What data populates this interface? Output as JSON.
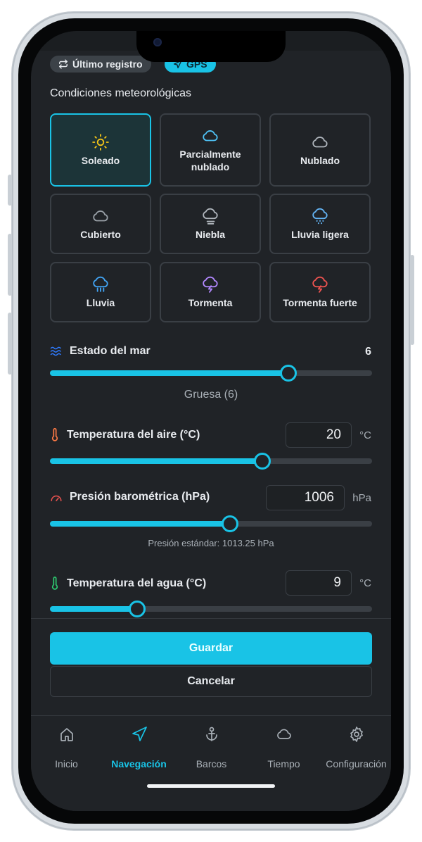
{
  "header": {
    "last_record_label": "Último registro",
    "gps_label": "GPS"
  },
  "weather": {
    "section_title": "Condiciones meteorológicas",
    "options": [
      {
        "label": "Soleado",
        "icon": "sun-icon",
        "color": "#f5c518",
        "selected": true
      },
      {
        "label": "Parcialmente nublado",
        "icon": "cloud-icon",
        "color": "#4fc3f7",
        "selected": false
      },
      {
        "label": "Nublado",
        "icon": "cloud-icon",
        "color": "#b0b6bd",
        "selected": false
      },
      {
        "label": "Cubierto",
        "icon": "cloud-icon",
        "color": "#9aa1a8",
        "selected": false
      },
      {
        "label": "Niebla",
        "icon": "fog-icon",
        "color": "#b0b6bd",
        "selected": false
      },
      {
        "label": "Lluvia ligera",
        "icon": "drizzle-icon",
        "color": "#64b5f6",
        "selected": false
      },
      {
        "label": "Lluvia",
        "icon": "rain-icon",
        "color": "#42a5f5",
        "selected": false
      },
      {
        "label": "Tormenta",
        "icon": "storm-icon",
        "color": "#b388ff",
        "selected": false
      },
      {
        "label": "Tormenta fuerte",
        "icon": "storm-icon",
        "color": "#ef5350",
        "selected": false
      }
    ]
  },
  "sea_state": {
    "label": "Estado del mar",
    "value": "6",
    "fraction": 0.74,
    "caption": "Gruesa (6)",
    "icon_color": "#2f7bff"
  },
  "air_temp": {
    "label": "Temperatura del aire (°C)",
    "value": "20",
    "unit": "°C",
    "fraction": 0.66,
    "icon_color": "#ff7a45"
  },
  "pressure": {
    "label": "Presión barométrica (hPa)",
    "value": "1006",
    "unit": "hPa",
    "fraction": 0.56,
    "caption": "Presión estándar: 1013.25 hPa",
    "icon_color": "#ef5350"
  },
  "water_temp": {
    "label": "Temperatura del agua (°C)",
    "value": "9",
    "unit": "°C",
    "fraction": 0.27,
    "icon_color": "#2ecc71"
  },
  "actions": {
    "save_label": "Guardar",
    "cancel_label": "Cancelar"
  },
  "tabs": [
    {
      "label": "Inicio",
      "icon": "home-icon",
      "active": false
    },
    {
      "label": "Navegación",
      "icon": "navigation-icon",
      "active": true
    },
    {
      "label": "Barcos",
      "icon": "anchor-icon",
      "active": false
    },
    {
      "label": "Tiempo",
      "icon": "cloud-icon",
      "active": false
    },
    {
      "label": "Configuración",
      "icon": "gear-icon",
      "active": false
    }
  ],
  "colors": {
    "accent": "#19c3e6",
    "background": "#202327"
  }
}
